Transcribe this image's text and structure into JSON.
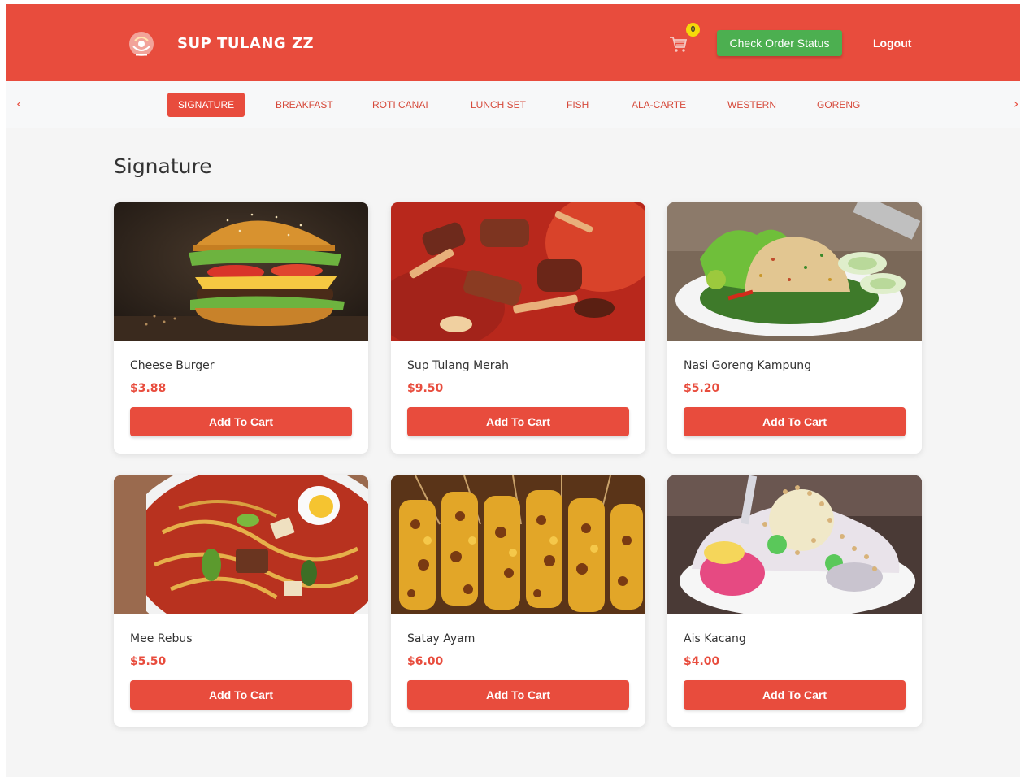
{
  "header": {
    "brand": "SUP TULANG ZZ",
    "cart_count": "0",
    "check_order_status": "Check Order Status",
    "logout": "Logout"
  },
  "nav": {
    "prev": "‹",
    "next": "›",
    "categories": [
      {
        "label": "SIGNATURE",
        "active": true
      },
      {
        "label": "BREAKFAST"
      },
      {
        "label": "ROTI CANAI"
      },
      {
        "label": "LUNCH SET"
      },
      {
        "label": "FISH"
      },
      {
        "label": "ALA-CARTE"
      },
      {
        "label": "WESTERN"
      },
      {
        "label": "GORENG"
      }
    ]
  },
  "section": {
    "title": "Signature"
  },
  "items": [
    {
      "name": "Cheese Burger",
      "price": "$3.88",
      "button": "Add To Cart"
    },
    {
      "name": "Sup Tulang Merah",
      "price": "$9.50",
      "button": "Add To Cart"
    },
    {
      "name": "Nasi Goreng Kampung",
      "price": "$5.20",
      "button": "Add To Cart"
    },
    {
      "name": "Mee Rebus",
      "price": "$5.50",
      "button": "Add To Cart"
    },
    {
      "name": "Satay Ayam",
      "price": "$6.00",
      "button": "Add To Cart"
    },
    {
      "name": "Ais Kacang",
      "price": "$4.00",
      "button": "Add To Cart"
    }
  ],
  "colors": {
    "primary": "#e84c3d",
    "success": "#4caf50",
    "badge": "#f5d90a"
  },
  "icons": {
    "logo": "restaurant-logo",
    "cart": "shopping-cart-icon"
  }
}
